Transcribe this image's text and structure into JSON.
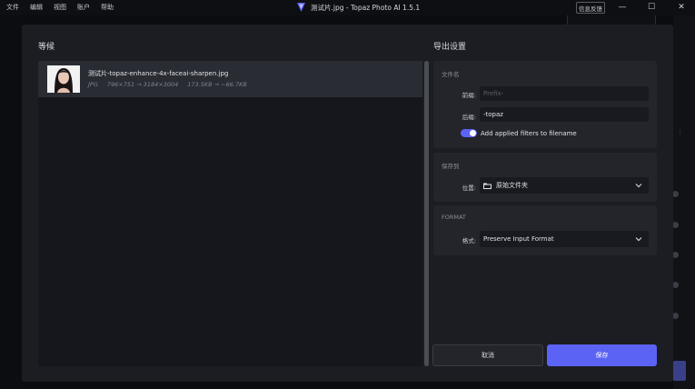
{
  "menu": {
    "items": [
      "文件",
      "编辑",
      "视图",
      "账户",
      "帮助"
    ]
  },
  "window": {
    "title": "测试片.jpg - Topaz Photo AI 1.5.1",
    "feedback_label": "信息反馈"
  },
  "left": {
    "title": "等候",
    "item": {
      "filename": "测试片-topaz-enhance-4x-faceai-sharpen.jpg",
      "format": "JPG",
      "dimensions": "796×751 → 3184×3004",
      "size": "173.5KB → ~66.7KB"
    }
  },
  "right": {
    "title": "导出设置",
    "filename_section": {
      "label": "文件名",
      "prefix_label": "前缀:",
      "prefix_placeholder": "Prefix-",
      "suffix_label": "后缀:",
      "suffix_value": "-topaz",
      "toggle_label": "Add applied filters to filename",
      "toggle_on": true
    },
    "save_section": {
      "label": "保存到",
      "location_label": "位置:",
      "location_value": "原始文件夹"
    },
    "format_section": {
      "label": "FORMAT",
      "format_label": "格式:",
      "format_value": "Preserve Input Format"
    },
    "cancel_label": "取消",
    "save_label": "保存"
  },
  "colors": {
    "accent": "#5b63f5",
    "modal_bg": "#1b1d22",
    "panel_bg": "#23252b"
  }
}
